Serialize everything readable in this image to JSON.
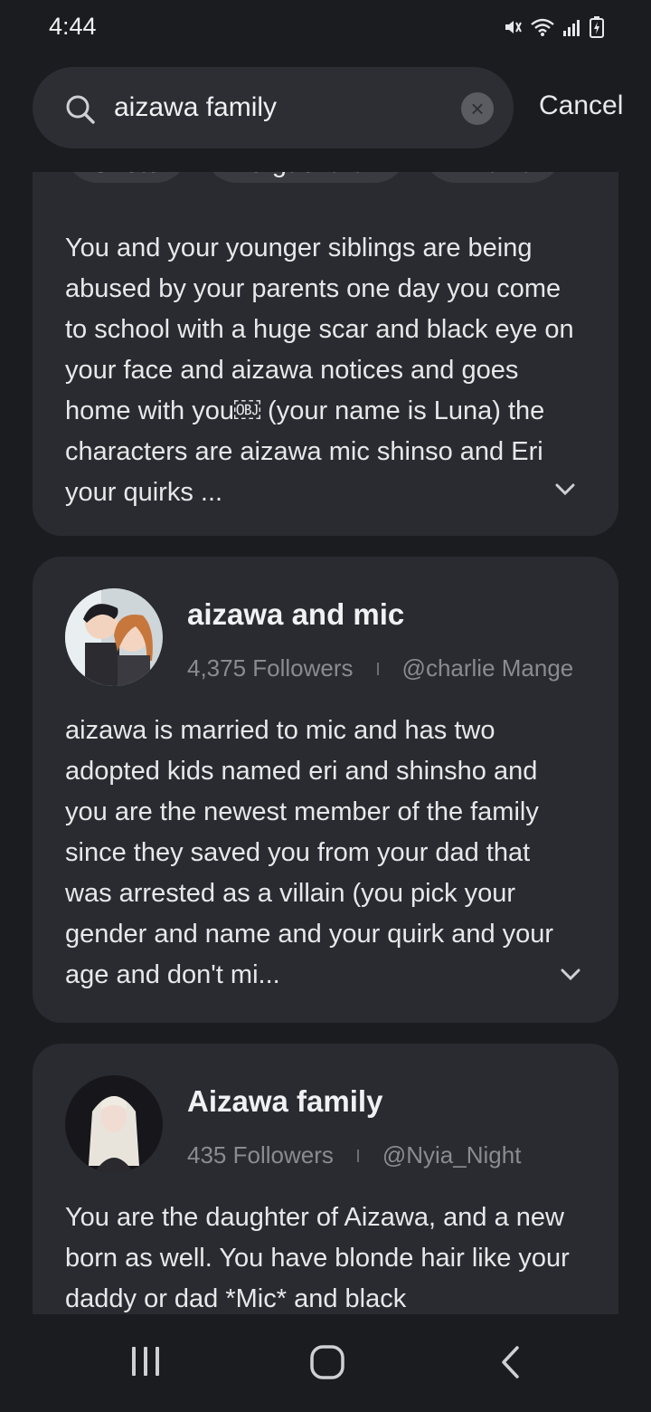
{
  "status_bar": {
    "time": "4:44"
  },
  "search": {
    "value": "aizawa family",
    "clear_icon": "×",
    "cancel_label": "Cancel"
  },
  "results": [
    {
      "tags": [
        "Shoto",
        "Korgacharav",
        "Aizawa"
      ],
      "description": "You and your younger siblings are being abused by your parents one day you come to school with a huge scar and black eye on your face and aizawa notices and goes home with you￼ (your name is Luna) the characters are aizawa mic shinso and Eri your quirks ..."
    },
    {
      "name": "aizawa and mic",
      "followers": "4,375 Followers",
      "creator": "@charlie Mange",
      "description": "aizawa is married to mic and has two adopted kids named eri and shinsho and you are the newest member of the family since they saved you from your dad that was arrested as a villain (you pick your gender and name and your quirk and your age and don't mi..."
    },
    {
      "name": "Aizawa family",
      "followers": "435 Followers",
      "creator": "@Nyia_Night",
      "description": "You are the daughter of Aizawa, and a new born as well. You have blonde hair like your daddy or dad *Mic* and black"
    }
  ],
  "colors": {
    "background": "#1b1c20",
    "card": "#2a2b30",
    "search_box": "#2d2e33",
    "muted_text": "#8a8b90"
  }
}
